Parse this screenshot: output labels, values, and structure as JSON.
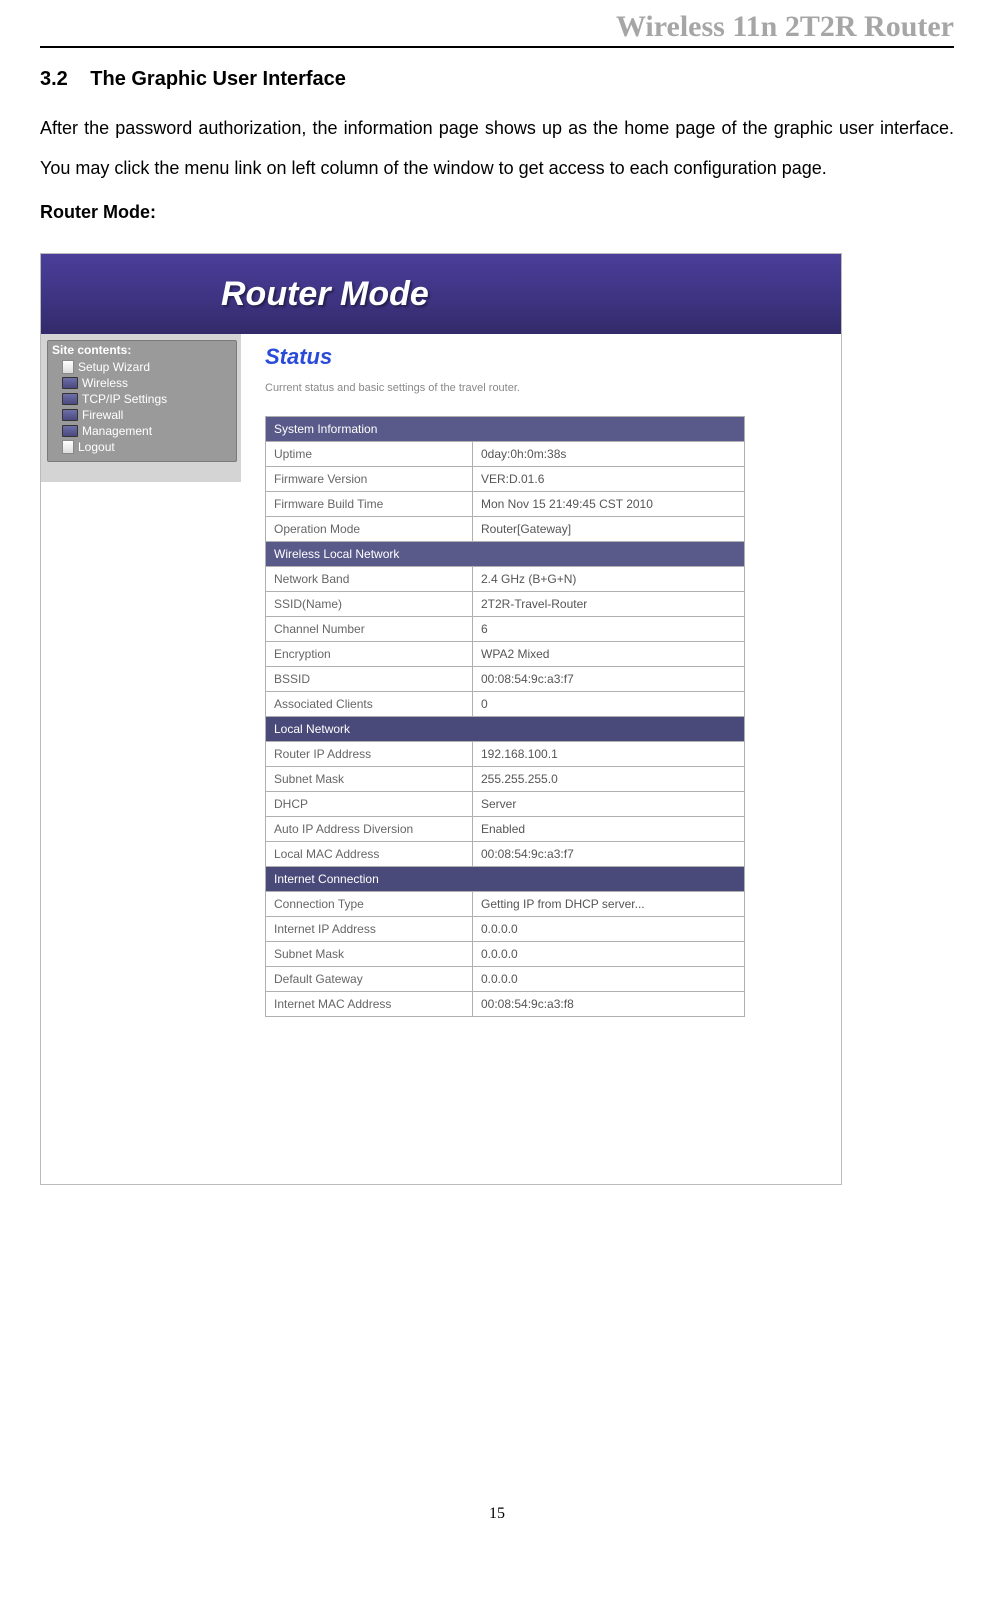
{
  "page_header": "Wireless 11n 2T2R Router",
  "section_number": "3.2",
  "section_title": "The Graphic User Interface",
  "body_paragraph": "After the password authorization, the information page shows up as the home page of the graphic user interface. You may click the menu link on left column of the window to get access to each configuration page.",
  "subheading": "Router Mode:",
  "page_number": "15",
  "screenshot": {
    "banner_title": "Router Mode",
    "sidebar": {
      "title": "Site contents:",
      "items": [
        {
          "label": "Setup Wizard",
          "icon": "page"
        },
        {
          "label": "Wireless",
          "icon": "folder"
        },
        {
          "label": "TCP/IP Settings",
          "icon": "folder"
        },
        {
          "label": "Firewall",
          "icon": "folder"
        },
        {
          "label": "Management",
          "icon": "folder"
        },
        {
          "label": "Logout",
          "icon": "page"
        }
      ]
    },
    "content": {
      "title": "Status",
      "subtitle": "Current status and basic settings of the travel router.",
      "sections": [
        {
          "header": "System Information",
          "rows": [
            {
              "k": "Uptime",
              "v": "0day:0h:0m:38s"
            },
            {
              "k": "Firmware Version",
              "v": "VER:D.01.6"
            },
            {
              "k": "Firmware Build Time",
              "v": "Mon Nov 15 21:49:45 CST 2010"
            },
            {
              "k": "Operation Mode",
              "v": "Router[Gateway]"
            }
          ]
        },
        {
          "header": "Wireless Local Network",
          "rows": [
            {
              "k": "Network Band",
              "v": "2.4 GHz (B+G+N)"
            },
            {
              "k": "SSID(Name)",
              "v": "2T2R-Travel-Router"
            },
            {
              "k": "Channel Number",
              "v": "6"
            },
            {
              "k": "Encryption",
              "v": "WPA2 Mixed"
            },
            {
              "k": "BSSID",
              "v": "00:08:54:9c:a3:f7"
            },
            {
              "k": "Associated Clients",
              "v": "0"
            }
          ]
        },
        {
          "header": "Local Network",
          "rows": [
            {
              "k": "Router IP Address",
              "v": "192.168.100.1"
            },
            {
              "k": "Subnet Mask",
              "v": "255.255.255.0"
            },
            {
              "k": "DHCP",
              "v": "Server"
            },
            {
              "k": "Auto IP Address Diversion",
              "v": "Enabled"
            },
            {
              "k": "Local MAC Address",
              "v": "00:08:54:9c:a3:f7"
            }
          ]
        },
        {
          "header": "Internet Connection",
          "rows": [
            {
              "k": "Connection Type",
              "v": "Getting IP from DHCP server..."
            },
            {
              "k": "Internet IP Address",
              "v": "0.0.0.0"
            },
            {
              "k": "Subnet Mask",
              "v": "0.0.0.0"
            },
            {
              "k": "Default Gateway",
              "v": "0.0.0.0"
            },
            {
              "k": "Internet MAC Address",
              "v": "00:08:54:9c:a3:f8"
            }
          ]
        }
      ]
    }
  }
}
